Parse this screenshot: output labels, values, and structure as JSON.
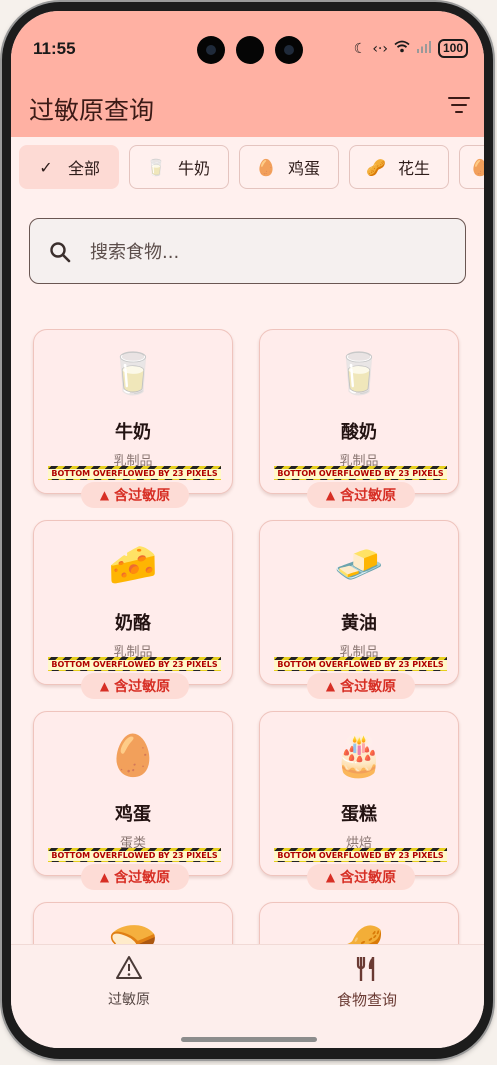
{
  "status": {
    "time": "11:55",
    "battery": "100"
  },
  "appbar": {
    "title": "过敏原查询"
  },
  "chips": [
    {
      "label": "全部",
      "icon": "✓",
      "selected": true
    },
    {
      "label": "牛奶",
      "icon": "🥛",
      "selected": false
    },
    {
      "label": "鸡蛋",
      "icon": "🥚",
      "selected": false
    },
    {
      "label": "花生",
      "icon": "🥜",
      "selected": false
    },
    {
      "label": "",
      "icon": "🥚",
      "selected": false
    }
  ],
  "search": {
    "placeholder": "搜索食物..."
  },
  "foods": [
    {
      "emoji": "🥛",
      "name": "牛奶",
      "category": "乳制品",
      "overflow": "BOTTOM OVERFLOWED BY 23 PIXELS",
      "badge": "含过敏原"
    },
    {
      "emoji": "🥛",
      "name": "酸奶",
      "category": "乳制品",
      "overflow": "BOTTOM OVERFLOWED BY 23 PIXELS",
      "badge": "含过敏原"
    },
    {
      "emoji": "🧀",
      "name": "奶酪",
      "category": "乳制品",
      "overflow": "BOTTOM OVERFLOWED BY 23 PIXELS",
      "badge": "含过敏原"
    },
    {
      "emoji": "🧈",
      "name": "黄油",
      "category": "乳制品",
      "overflow": "BOTTOM OVERFLOWED BY 23 PIXELS",
      "badge": "含过敏原"
    },
    {
      "emoji": "🥚",
      "name": "鸡蛋",
      "category": "蛋类",
      "overflow": "BOTTOM OVERFLOWED BY 23 PIXELS",
      "badge": "含过敏原"
    },
    {
      "emoji": "🎂",
      "name": "蛋糕",
      "category": "烘焙",
      "overflow": "BOTTOM OVERFLOWED BY 23 PIXELS",
      "badge": "含过敏原"
    },
    {
      "emoji": "🍞",
      "name": "",
      "category": "",
      "overflow": "",
      "badge": ""
    },
    {
      "emoji": "🥜",
      "name": "",
      "category": "",
      "overflow": "",
      "badge": ""
    }
  ],
  "nav": [
    {
      "label": "过敏原",
      "icon": "⚠",
      "active": false
    },
    {
      "label": "食物查询",
      "icon": "🍴",
      "active": true
    }
  ],
  "colors": {
    "appbar": "#ffb1a3",
    "background": "#fff0ee",
    "badge_text": "#d72f25"
  }
}
